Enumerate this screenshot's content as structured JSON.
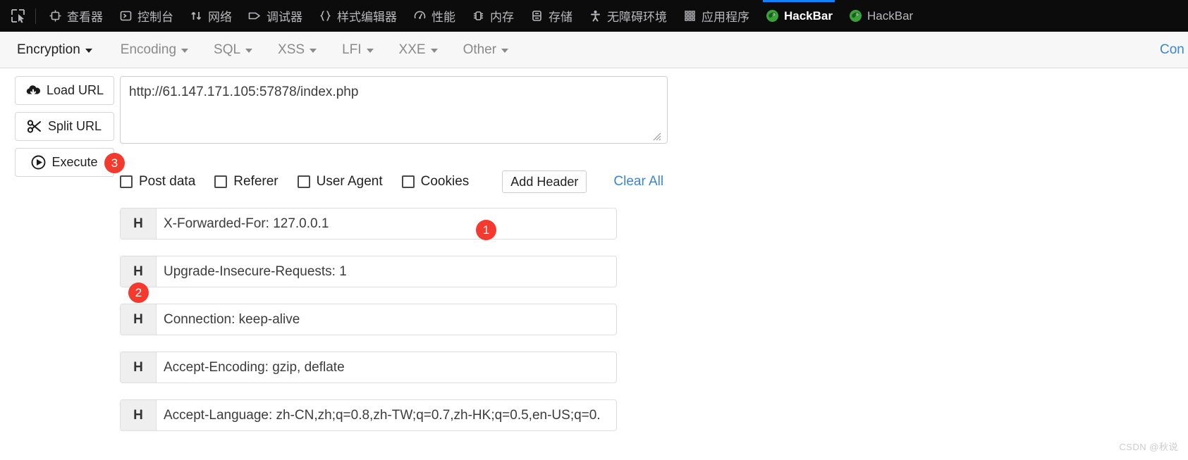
{
  "devtools": {
    "picker_icon": "element-picker-icon",
    "tabs": [
      {
        "label": "查看器",
        "icon": "inspector-icon",
        "active": false
      },
      {
        "label": "控制台",
        "icon": "console-icon",
        "active": false
      },
      {
        "label": "网络",
        "icon": "network-icon",
        "active": false
      },
      {
        "label": "调试器",
        "icon": "debugger-icon",
        "active": false
      },
      {
        "label": "样式编辑器",
        "icon": "style-editor-icon",
        "active": false
      },
      {
        "label": "性能",
        "icon": "performance-icon",
        "active": false
      },
      {
        "label": "内存",
        "icon": "memory-icon",
        "active": false
      },
      {
        "label": "存储",
        "icon": "storage-icon",
        "active": false
      },
      {
        "label": "无障碍环境",
        "icon": "accessibility-icon",
        "active": false
      },
      {
        "label": "应用程序",
        "icon": "application-icon",
        "active": false
      },
      {
        "label": "HackBar",
        "icon": "firefox-addon-icon",
        "active": true
      },
      {
        "label": "HackBar",
        "icon": "firefox-addon-icon",
        "active": false
      }
    ],
    "active_tab_underline_color": "#0a84ff",
    "background_color": "#0c0c0d"
  },
  "hackbar": {
    "menus": [
      {
        "label": "Encryption",
        "has_caret": true,
        "emphasized": true
      },
      {
        "label": "Encoding",
        "has_caret": true,
        "emphasized": false
      },
      {
        "label": "SQL",
        "has_caret": true,
        "emphasized": false
      },
      {
        "label": "XSS",
        "has_caret": true,
        "emphasized": false
      },
      {
        "label": "LFI",
        "has_caret": true,
        "emphasized": false
      },
      {
        "label": "XXE",
        "has_caret": true,
        "emphasized": false
      },
      {
        "label": "Other",
        "has_caret": true,
        "emphasized": false
      }
    ],
    "menu_right_truncated": "Con",
    "menu_right_color": "#3b86d0",
    "actions": [
      {
        "label": "Load URL",
        "icon": "cloud-download-icon",
        "badge": null
      },
      {
        "label": "Split URL",
        "icon": "scissors-icon",
        "badge": null
      },
      {
        "label": "Execute",
        "icon": "play-circle-icon",
        "badge": "3"
      }
    ],
    "url": {
      "value": "http://61.147.171.105:57878/index.php",
      "placeholder": "Enter URL"
    },
    "options": [
      {
        "label": "Post data",
        "checked": false
      },
      {
        "label": "Referer",
        "checked": false
      },
      {
        "label": "User Agent",
        "checked": false
      },
      {
        "label": "Cookies",
        "checked": false
      }
    ],
    "add_header_label": "Add Header",
    "add_header_badge": "1",
    "clear_all_label": "Clear All",
    "headers": [
      {
        "prefix": "H",
        "value": "X-Forwarded-For: 127.0.0.1",
        "badge": "2"
      },
      {
        "prefix": "H",
        "value": "Upgrade-Insecure-Requests: 1",
        "badge": null
      },
      {
        "prefix": "H",
        "value": "Connection: keep-alive",
        "badge": null
      },
      {
        "prefix": "H",
        "value": "Accept-Encoding: gzip, deflate",
        "badge": null
      },
      {
        "prefix": "H",
        "value": "Accept-Language: zh-CN,zh;q=0.8,zh-TW;q=0.7,zh-HK;q=0.5,en-US;q=0.",
        "badge": null
      }
    ],
    "badge_color": "#f4392f"
  },
  "watermark": "CSDN @秋说"
}
